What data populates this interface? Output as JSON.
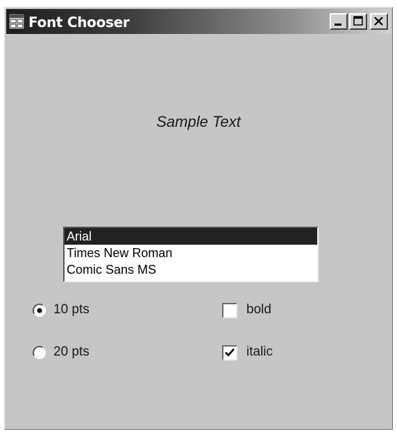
{
  "window": {
    "title": "Font Chooser",
    "icon": "app-icon",
    "caption_buttons": [
      "minimize",
      "maximize",
      "close"
    ]
  },
  "sample_text": "Sample Text",
  "font_list": {
    "items": [
      "Arial",
      "Times New Roman",
      "Comic Sans MS"
    ],
    "selected": "Arial"
  },
  "size_options": [
    {
      "label": "10 pts",
      "selected": true
    },
    {
      "label": "20 pts",
      "selected": false
    }
  ],
  "style_options": [
    {
      "label": "bold",
      "checked": false
    },
    {
      "label": "italic",
      "checked": true
    }
  ],
  "colors": {
    "selection_bg": "#222222",
    "window_bg": "#c6c6c6"
  }
}
